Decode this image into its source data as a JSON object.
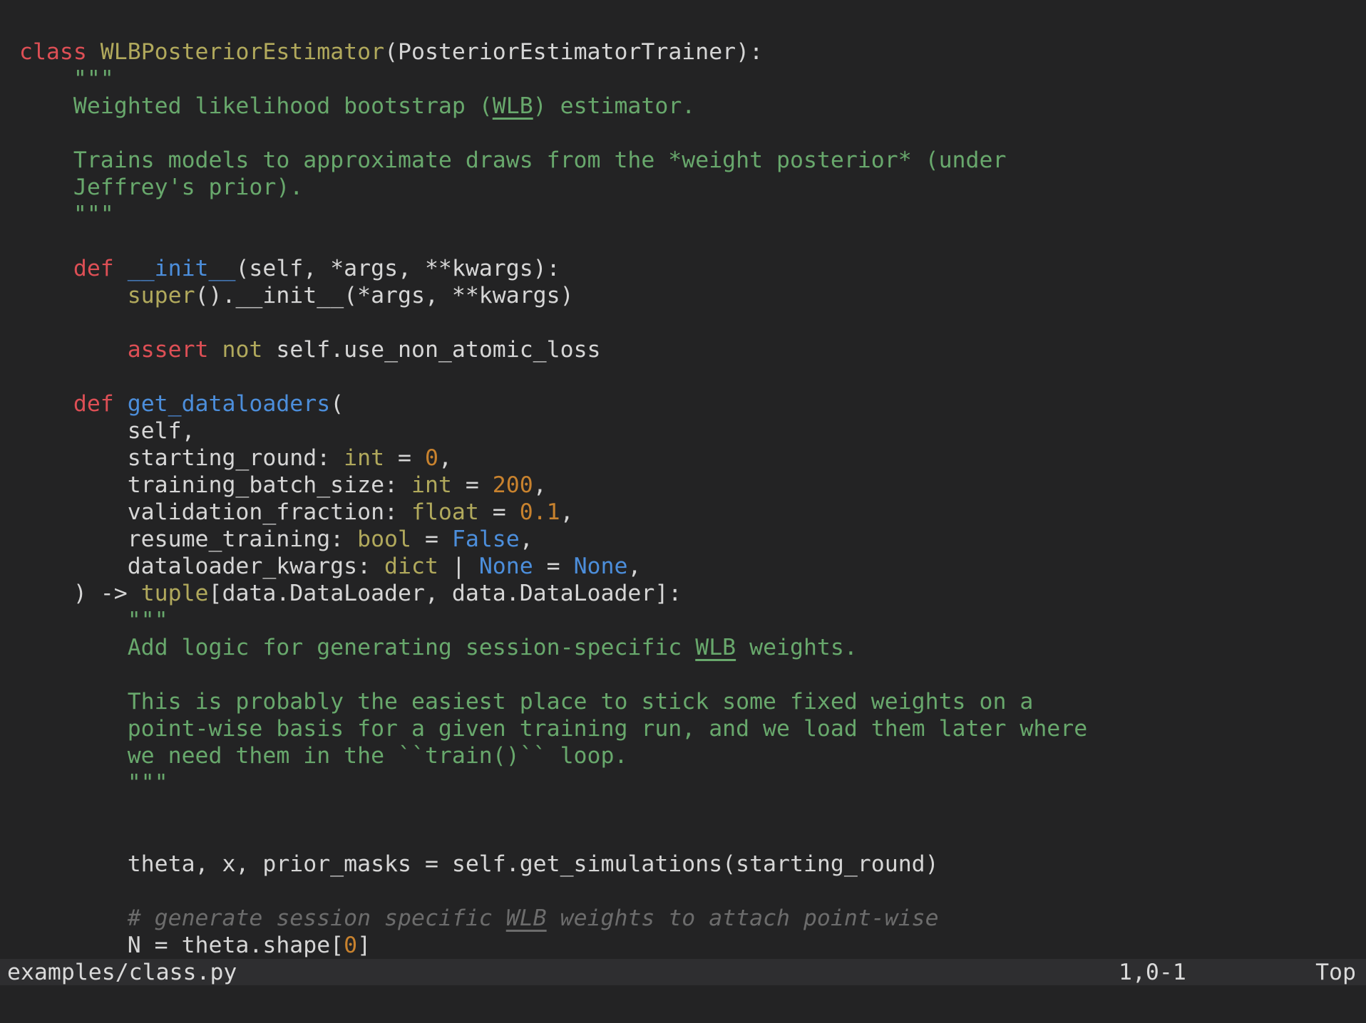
{
  "window": {
    "kind": "vim-editor",
    "background": "#232324"
  },
  "palette": {
    "background": "#232324",
    "statusbar_background": "#2e2e30",
    "default_text": "#d6d6d6",
    "keyword_red": "#dd4f55",
    "builtin_olive": "#b1a95c",
    "function_blue": "#4c8edb",
    "constant_blue": "#4c8edb",
    "number_orange": "#c8822e",
    "string_green": "#68a86c",
    "comment_gray": "#6c6c6c"
  },
  "editor": {
    "lines": [
      [
        [
          "kw",
          "class"
        ],
        [
          "df",
          " "
        ],
        [
          "ty",
          "WLBPosteriorEstimator"
        ],
        [
          "df",
          "(PosteriorEstimatorTrainer):"
        ]
      ],
      [
        [
          "str",
          "    \"\"\""
        ]
      ],
      [
        [
          "str",
          "    Weighted likelihood bootstrap ("
        ],
        [
          "strU",
          "WLB"
        ],
        [
          "str",
          ") estimator."
        ]
      ],
      [],
      [
        [
          "str",
          "    Trains models to approximate draws from the *weight posterior* (under"
        ]
      ],
      [
        [
          "str",
          "    Jeffrey's prior)."
        ]
      ],
      [
        [
          "str",
          "    \"\"\""
        ]
      ],
      [],
      [
        [
          "df",
          "    "
        ],
        [
          "kw",
          "def"
        ],
        [
          "df",
          " "
        ],
        [
          "fn",
          "__init__"
        ],
        [
          "df",
          "(self, *args, **kwargs):"
        ]
      ],
      [
        [
          "df",
          "        "
        ],
        [
          "ty",
          "super"
        ],
        [
          "df",
          "().__init__(*args, **kwargs)"
        ]
      ],
      [],
      [
        [
          "df",
          "        "
        ],
        [
          "kw",
          "assert"
        ],
        [
          "df",
          " "
        ],
        [
          "ty",
          "not"
        ],
        [
          "df",
          " self.use_non_atomic_loss"
        ]
      ],
      [],
      [
        [
          "df",
          "    "
        ],
        [
          "kw",
          "def"
        ],
        [
          "df",
          " "
        ],
        [
          "fn",
          "get_dataloaders"
        ],
        [
          "df",
          "("
        ]
      ],
      [
        [
          "df",
          "        self,"
        ]
      ],
      [
        [
          "df",
          "        starting_round: "
        ],
        [
          "ty",
          "int"
        ],
        [
          "df",
          " = "
        ],
        [
          "num",
          "0"
        ],
        [
          "df",
          ","
        ]
      ],
      [
        [
          "df",
          "        training_batch_size: "
        ],
        [
          "ty",
          "int"
        ],
        [
          "df",
          " = "
        ],
        [
          "num",
          "200"
        ],
        [
          "df",
          ","
        ]
      ],
      [
        [
          "df",
          "        validation_fraction: "
        ],
        [
          "ty",
          "float"
        ],
        [
          "df",
          " = "
        ],
        [
          "num",
          "0.1"
        ],
        [
          "df",
          ","
        ]
      ],
      [
        [
          "df",
          "        resume_training: "
        ],
        [
          "ty",
          "bool"
        ],
        [
          "df",
          " = "
        ],
        [
          "blue",
          "False"
        ],
        [
          "df",
          ","
        ]
      ],
      [
        [
          "df",
          "        dataloader_kwargs: "
        ],
        [
          "ty",
          "dict"
        ],
        [
          "df",
          " | "
        ],
        [
          "blue",
          "None"
        ],
        [
          "df",
          " = "
        ],
        [
          "blue",
          "None"
        ],
        [
          "df",
          ","
        ]
      ],
      [
        [
          "df",
          "    ) -> "
        ],
        [
          "ty",
          "tuple"
        ],
        [
          "df",
          "[data.DataLoader, data.DataLoader]:"
        ]
      ],
      [
        [
          "str",
          "        \"\"\""
        ]
      ],
      [
        [
          "str",
          "        Add logic for generating session-specific "
        ],
        [
          "strU",
          "WLB"
        ],
        [
          "str",
          " weights."
        ]
      ],
      [],
      [
        [
          "str",
          "        This is probably the easiest place to stick some fixed weights on a"
        ]
      ],
      [
        [
          "str",
          "        point-wise basis for a given training run, and we load them later where"
        ]
      ],
      [
        [
          "str",
          "        we need them in the ``train()`` loop."
        ]
      ],
      [
        [
          "str",
          "        \"\"\""
        ]
      ],
      [],
      [],
      [
        [
          "df",
          "        theta, x, prior_masks = self.get_simulations(starting_round)"
        ]
      ],
      [],
      [
        [
          "com",
          "        # generate session specific "
        ],
        [
          "comU",
          "WLB"
        ],
        [
          "com",
          " weights to attach point-wise"
        ]
      ],
      [
        [
          "df",
          "        N = theta.shape["
        ],
        [
          "num",
          "0"
        ],
        [
          "df",
          "]"
        ]
      ]
    ]
  },
  "statusbar": {
    "filename": "examples/class.py",
    "cursor_position": "1,0-1",
    "scroll_indicator": "Top"
  }
}
